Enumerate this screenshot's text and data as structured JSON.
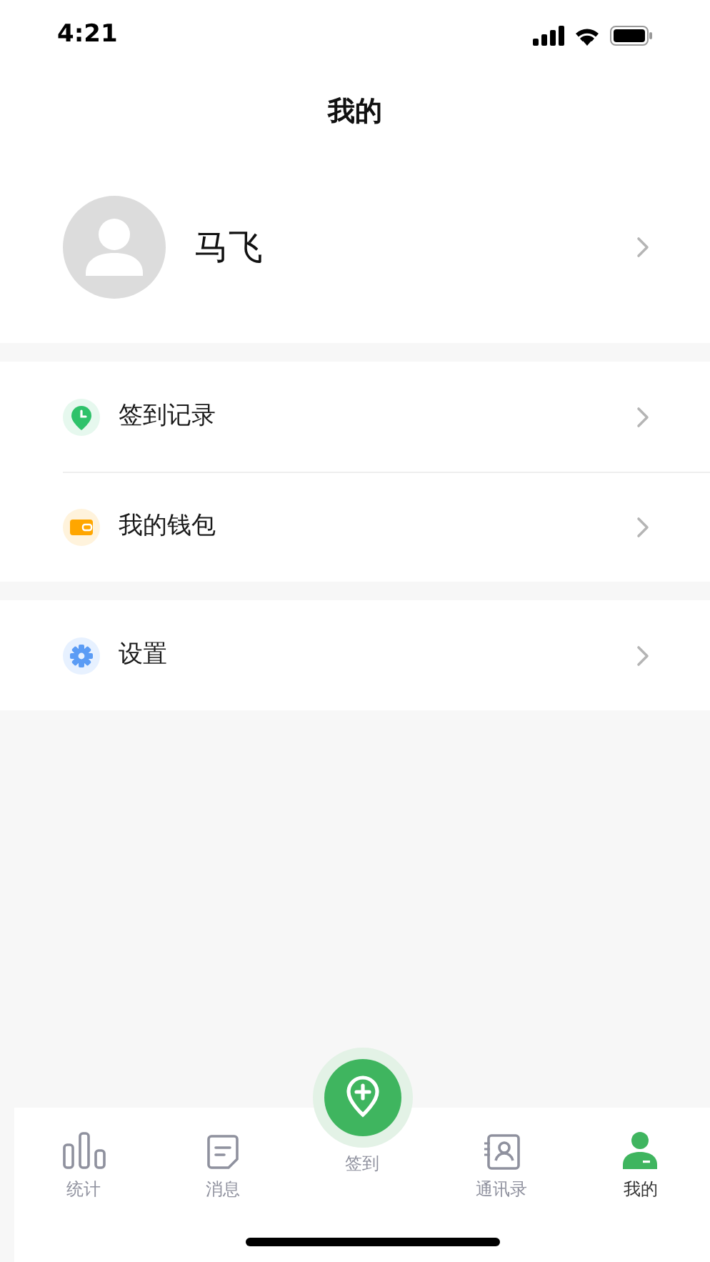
{
  "status_bar": {
    "time": "4:21"
  },
  "header": {
    "title": "我的"
  },
  "profile": {
    "name": "马飞"
  },
  "menu_groups": [
    [
      {
        "label": "签到记录",
        "kind": "checkin"
      },
      {
        "label": "我的钱包",
        "kind": "wallet"
      }
    ],
    [
      {
        "label": "设置",
        "kind": "settings"
      }
    ]
  ],
  "tab_bar": [
    {
      "label": "统计",
      "kind": "stats",
      "selected": false
    },
    {
      "label": "消息",
      "kind": "messages",
      "selected": false
    },
    {
      "label": "签到",
      "kind": "checkin",
      "selected": false
    },
    {
      "label": "通讯录",
      "kind": "contacts",
      "selected": false
    },
    {
      "label": "我的",
      "kind": "me",
      "selected": true
    }
  ]
}
